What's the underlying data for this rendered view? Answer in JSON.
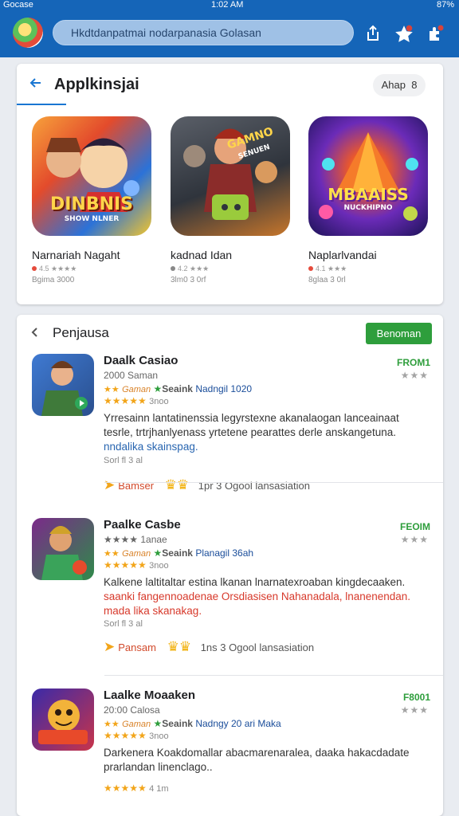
{
  "status": {
    "carrier": "Gocase",
    "time": "1:02 AM",
    "battery": "87%"
  },
  "topbar": {
    "search_placeholder": "Hkdtdanpatmai nodarpanasia Golasan",
    "icons": [
      "share-icon",
      "star-icon",
      "puzzle-icon"
    ]
  },
  "featured": {
    "title": "Applkinsjai",
    "sort_label": "Ahap",
    "sort_count": "8",
    "apps": [
      {
        "name": "Narnariah Nagaht",
        "rating": "4.5 ★★★★",
        "meta": "Bgima 3000",
        "art_title": "DINBNIS",
        "art_sub": "SHOW NLNER",
        "colors": [
          "#f36b2b",
          "#2a6fd6"
        ]
      },
      {
        "name": "kadnad Idan",
        "rating": "4.2 ★★★",
        "meta": "3lm0 3 0rf",
        "art_title": "GAMNO",
        "art_sub": "SENUEN",
        "colors": [
          "#4c4f56",
          "#d1802a"
        ]
      },
      {
        "name": "Naplarlvandai",
        "rating": "4.1 ★★★",
        "meta": "8glaa 3 0rl",
        "art_title": "MBAAISS",
        "art_sub": "NUCKHIPNO",
        "colors": [
          "#6a2fc0",
          "#f0a52a"
        ]
      }
    ]
  },
  "list": {
    "title": "Penjausa",
    "button_label": "Benoman",
    "items": [
      {
        "name": "Daalk Casiao",
        "sub": "2000 Saman",
        "price": "FROM1",
        "price_stars": "★★★",
        "tag1": "Gaman",
        "tag2": "Seaink",
        "tag3": "Nadngil 1020",
        "size": "3noo",
        "desc_a": "Yrresainn lantatinenssia legyrstexne akanalaogan lanceainaat tesrle, trtrjhanlyenass yrtetene pearattes derle anskangetuna.",
        "desc_b": "nndalika skainspag.",
        "small": "Sorl fl 3 al",
        "foot_tag": "Bamser",
        "foot_count": "1pr 3 Ogool lansasiation",
        "colors": [
          "#2f7a3a",
          "#f5c547"
        ]
      },
      {
        "name": "Paalke Casbe",
        "sub": "★★★★ 1anae",
        "price": "FEOIM",
        "price_stars": "★★★",
        "tag1": "Gaman",
        "tag2": "Seaink",
        "tag3": "Planagil 36ah",
        "size": "3noo",
        "desc_a": "Kalkene laltitaltar estina lkanan lnarnatexroaban kingdecaaken.",
        "desc_b": "saanki fangennoadenae Orsdiasisen Nahanadala, lnanenendan. mada lika skanakag.",
        "small": "Sorl fl 3 al",
        "foot_tag": "Pansam",
        "foot_count": "1ns 3 Ogool lansasiation",
        "colors": [
          "#7b2a8a",
          "#3aa35a"
        ]
      },
      {
        "name": "Laalke Moaaken",
        "sub": "20:00 Calosa",
        "price": "F8001",
        "price_stars": "★★★",
        "tag1": "Gaman",
        "tag2": "Seaink",
        "tag3": "Nadngy 20 ari Maka",
        "size": "3noo",
        "desc_a": "Darkenera Koakdomallar abacmarenaralea, daaka hakacdadate prarlandan linenclago..",
        "desc_b": "",
        "small": "",
        "foot_tag": "",
        "foot_count": "",
        "colors": [
          "#f0b93a",
          "#c8344a"
        ]
      }
    ]
  }
}
